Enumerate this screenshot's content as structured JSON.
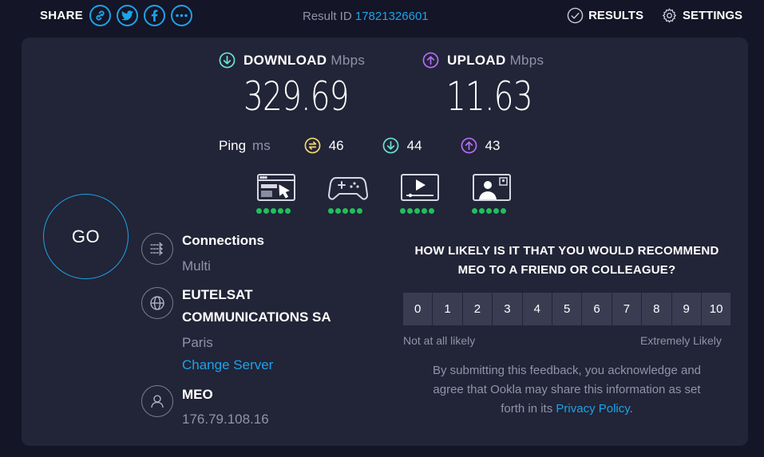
{
  "header": {
    "share_label": "SHARE",
    "share_buttons": [
      {
        "icon": "link-icon"
      },
      {
        "icon": "twitter-icon"
      },
      {
        "icon": "facebook-icon"
      },
      {
        "icon": "more-icon"
      }
    ],
    "result_label": "Result ID",
    "result_id": "17821326601",
    "results_label": "RESULTS",
    "settings_label": "SETTINGS"
  },
  "download": {
    "label": "DOWNLOAD",
    "unit": "Mbps",
    "value": "329.69",
    "color": "#6ae0d3"
  },
  "upload": {
    "label": "UPLOAD",
    "unit": "Mbps",
    "value": "11.63",
    "color": "#b26df3"
  },
  "ping": {
    "label": "Ping",
    "unit": "ms",
    "idle": "46",
    "download": "44",
    "upload": "43",
    "idle_color": "#f3d96a"
  },
  "quality_icons": [
    {
      "icon": "browsing-icon",
      "rating": 5
    },
    {
      "icon": "gaming-icon",
      "rating": 5
    },
    {
      "icon": "streaming-icon",
      "rating": 5
    },
    {
      "icon": "video-chat-icon",
      "rating": 5
    }
  ],
  "go_label": "GO",
  "connections": {
    "title": "Connections",
    "value": "Multi"
  },
  "server": {
    "title_line1": "EUTELSAT",
    "title_line2": "COMMUNICATIONS SA",
    "location": "Paris",
    "change_label": "Change Server"
  },
  "isp": {
    "name": "MEO",
    "ip": "176.79.108.16"
  },
  "survey": {
    "question_line1": "HOW LIKELY IS IT THAT YOU WOULD RECOMMEND",
    "question_line2": "MEO TO A FRIEND OR COLLEAGUE?",
    "scale": [
      "0",
      "1",
      "2",
      "3",
      "4",
      "5",
      "6",
      "7",
      "8",
      "9",
      "10"
    ],
    "low_label": "Not at all likely",
    "high_label": "Extremely Likely",
    "disclaimer_line1": "By submitting this feedback, you acknowledge and",
    "disclaimer_line2": "agree that Ookla may share this information as set",
    "disclaimer_line3": "forth in its",
    "privacy_label": "Privacy Policy",
    "period": "."
  },
  "colors": {
    "accent": "#1ca3e8",
    "background": "#141526",
    "card": "#222437",
    "quality_dot": "#20c05c"
  }
}
